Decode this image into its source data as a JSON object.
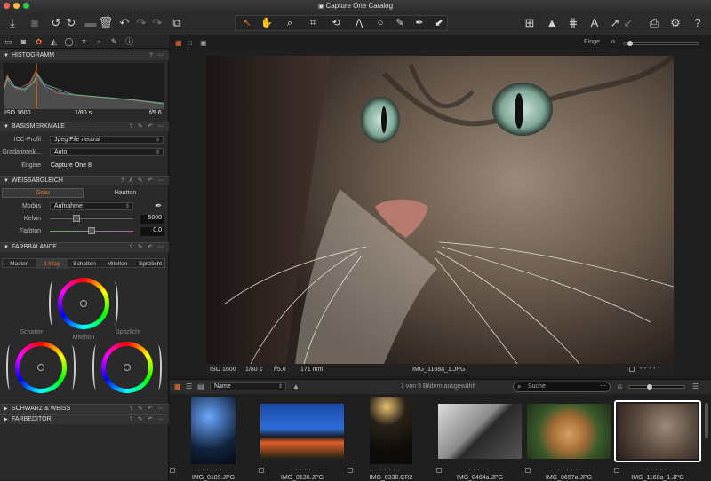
{
  "window": {
    "title": "Capture One Catalog"
  },
  "toolbar": {
    "search_placeholder": "Suche"
  },
  "viewer_header": {
    "label": "Einge..."
  },
  "histogram": {
    "title": "HISTOGRAMM",
    "iso": "ISO 1600",
    "shutter": "1/80 s",
    "aperture": "f/5.6"
  },
  "basismerkmale": {
    "title": "BASISMERKMALE",
    "icc_label": "ICC-Profil",
    "icc_value": "Jpeg File neutral",
    "grad_label": "Gradationsk...",
    "grad_value": "Auto",
    "engine_label": "Engine",
    "engine_value": "Capture One 8"
  },
  "weissabgleich": {
    "title": "WEISSABGLEICH",
    "tab_grau": "Grau",
    "tab_hautton": "Hautton",
    "modus_label": "Modus",
    "modus_value": "Aufnahme",
    "kelvin_label": "Kelvin",
    "kelvin_value": "5000",
    "farbton_label": "Farbton",
    "farbton_value": "0.0"
  },
  "farbbalance": {
    "title": "FARBBALANCE",
    "tabs": [
      "Master",
      "3-Way",
      "Schatten",
      "Mitelton",
      "Spitzlicht"
    ],
    "wheel_mitelton": "Mitelton",
    "wheel_schatten": "Schatten",
    "wheel_spitzlicht": "Spitzlicht"
  },
  "collapsed": {
    "schwarzweiss": "SCHWARZ & WEISS",
    "farbeditor": "FARBEDITOR"
  },
  "infobar": {
    "iso": "ISO 1600",
    "shutter": "1/80 s",
    "aperture": "f/5.6",
    "focal": "171 mm",
    "filename": "IMG_1168a_1.JPG"
  },
  "browser": {
    "sort_value": "Name",
    "status": "1 von 9 Bildern ausgewählt",
    "search_placeholder": "Suche"
  },
  "thumbnails": [
    {
      "name": "IMG_0109.JPG"
    },
    {
      "name": "IMG_0136.JPG"
    },
    {
      "name": "IMG_0330.CR2"
    },
    {
      "name": "IMG_0464a.JPG"
    },
    {
      "name": "IMG_0657a.JPG"
    },
    {
      "name": "IMG_1168a_1.JPG"
    }
  ],
  "colors": {
    "accent": "#e8772e",
    "selection": "#ffffff"
  }
}
